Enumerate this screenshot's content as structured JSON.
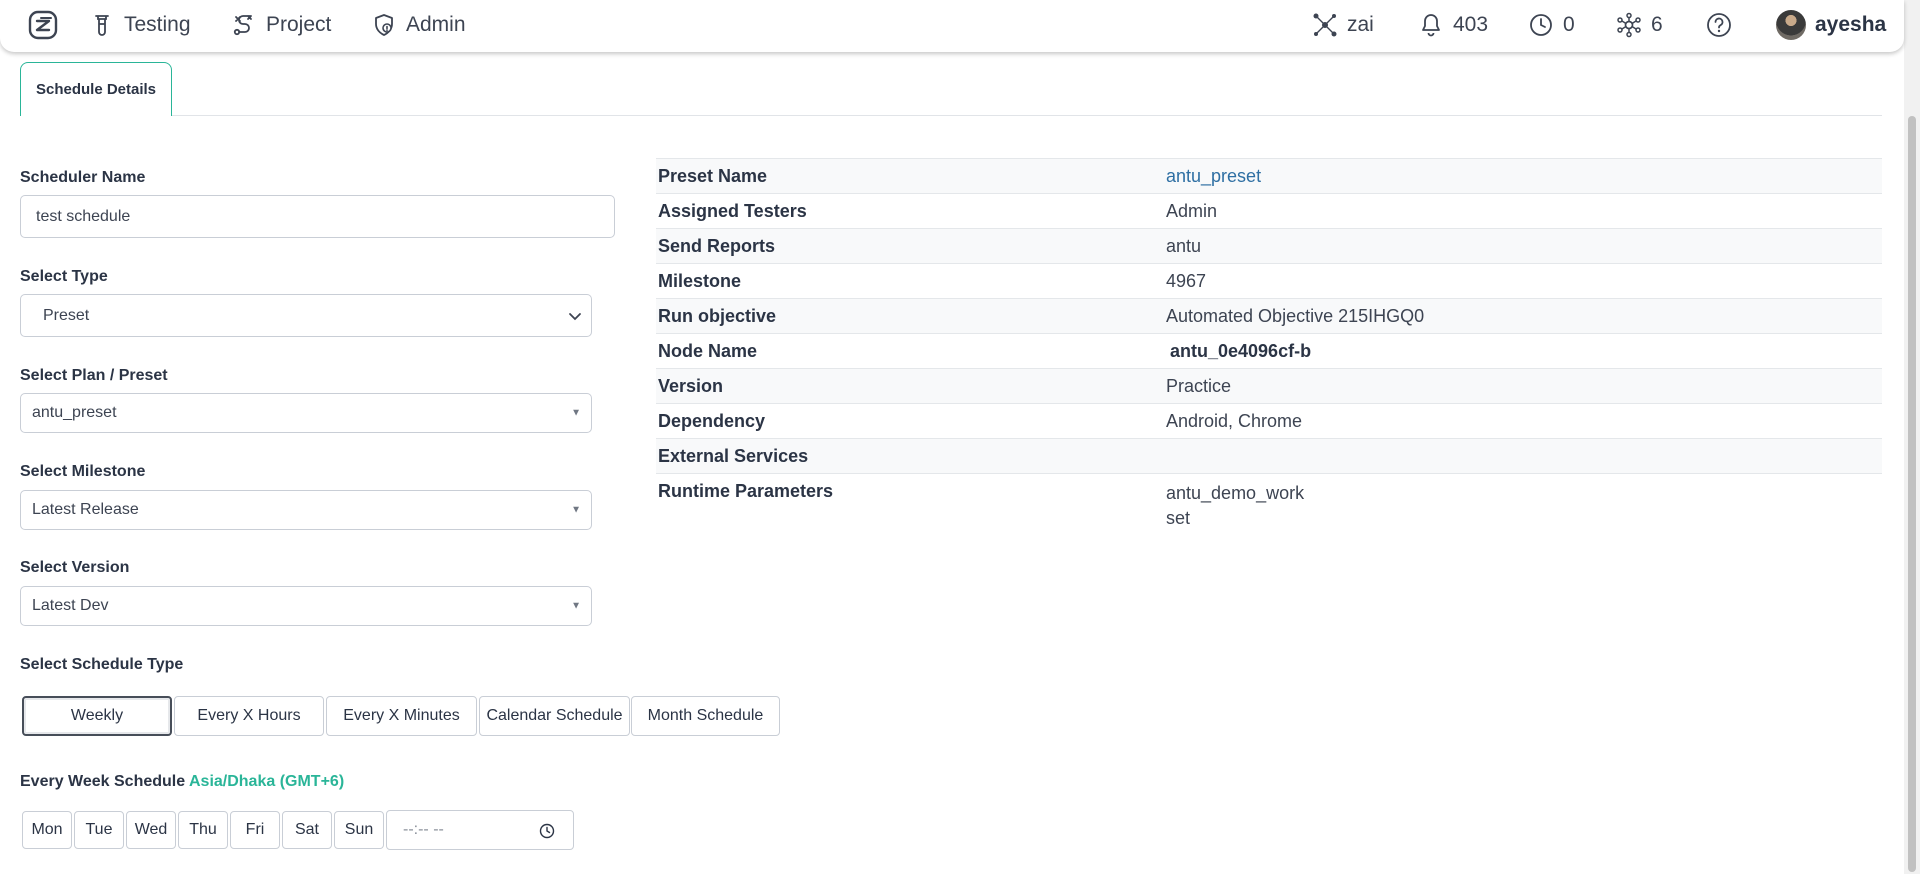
{
  "navbar": {
    "items": [
      {
        "label": "Testing",
        "icon": "flask-icon"
      },
      {
        "label": "Project",
        "icon": "route-icon"
      },
      {
        "label": "Admin",
        "icon": "shield-icon"
      }
    ],
    "right": {
      "ai_label": "zai",
      "notifications_count": "403",
      "history_count": "0",
      "nodes_count": "6",
      "username": "ayesha"
    }
  },
  "tabs": {
    "active": "Schedule Details"
  },
  "form": {
    "scheduler_name_label": "Scheduler Name",
    "scheduler_name_value": "test schedule",
    "select_type_label": "Select Type",
    "select_type_value": "Preset",
    "select_plan_label": "Select Plan / Preset",
    "select_plan_value": "antu_preset",
    "select_milestone_label": "Select Milestone",
    "select_milestone_value": "Latest Release",
    "select_version_label": "Select Version",
    "select_version_value": "Latest Dev",
    "schedule_type_label": "Select Schedule Type",
    "schedule_types": [
      "Weekly",
      "Every X Hours",
      "Every X Minutes",
      "Calendar Schedule",
      "Month Schedule"
    ],
    "week_schedule_label": "Every Week Schedule",
    "timezone": "Asia/Dhaka (GMT+6)",
    "days": [
      "Mon",
      "Tue",
      "Wed",
      "Thu",
      "Fri",
      "Sat",
      "Sun"
    ],
    "time_placeholder": "--:-- --"
  },
  "details": {
    "rows": [
      {
        "key": "Preset Name",
        "value": "antu_preset"
      },
      {
        "key": "Assigned Testers",
        "value": "Admin"
      },
      {
        "key": "Send Reports",
        "value": "antu"
      },
      {
        "key": "Milestone",
        "value": "4967"
      },
      {
        "key": "Run objective",
        "value": "Automated Objective 215IHGQ0"
      },
      {
        "key": "Node Name",
        "value": "antu_0e4096cf-b"
      },
      {
        "key": "Version",
        "value": "Practice"
      },
      {
        "key": "Dependency",
        "value": "Android, Chrome"
      },
      {
        "key": "External Services",
        "value": ""
      },
      {
        "key": "Runtime Parameters",
        "value_line1": "antu_demo_work",
        "value_line2": "set"
      }
    ]
  },
  "colors": {
    "accent": "#2ab598",
    "link": "#2e6fa3",
    "text": "#2b3445"
  }
}
